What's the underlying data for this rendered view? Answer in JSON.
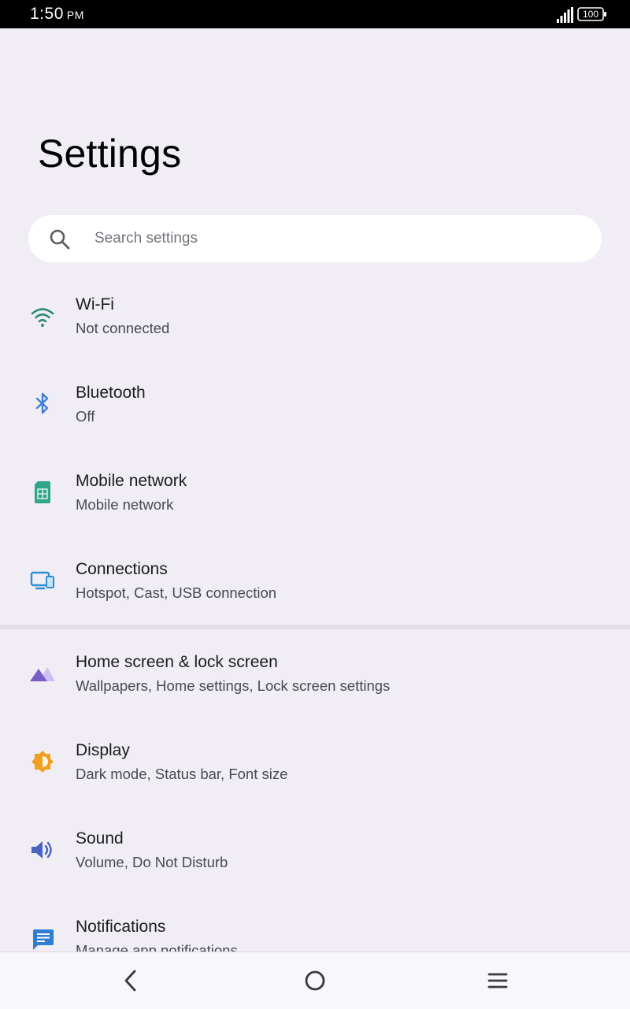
{
  "status_bar": {
    "time": "1:50",
    "ampm": "PM",
    "battery": "100"
  },
  "page": {
    "title": "Settings"
  },
  "search": {
    "placeholder": "Search settings"
  },
  "items": [
    {
      "title": "Wi-Fi",
      "subtitle": "Not connected",
      "icon": "wifi-icon",
      "color": "#2e8b7a"
    },
    {
      "title": "Bluetooth",
      "subtitle": "Off",
      "icon": "bluetooth-icon",
      "color": "#3d7fd6"
    },
    {
      "title": "Mobile network",
      "subtitle": "Mobile network",
      "icon": "sim-card-icon",
      "color": "#2fa58a"
    },
    {
      "title": "Connections",
      "subtitle": "Hotspot, Cast, USB connection",
      "icon": "devices-icon",
      "color": "#2f8fd1"
    },
    {
      "title": "Home screen & lock screen",
      "subtitle": "Wallpapers, Home settings, Lock screen settings",
      "icon": "wallpaper-icon",
      "color": "#7a5cc9"
    },
    {
      "title": "Display",
      "subtitle": "Dark mode, Status bar, Font size",
      "icon": "brightness-icon",
      "color": "#f0a020"
    },
    {
      "title": "Sound",
      "subtitle": "Volume, Do Not Disturb",
      "icon": "volume-icon",
      "color": "#4a63c4"
    },
    {
      "title": "Notifications",
      "subtitle": "Manage app notifications",
      "icon": "notification-icon",
      "color": "#2f7ed1"
    }
  ],
  "nav": {
    "back": "back-icon",
    "home": "home-icon",
    "menu": "menu-icon"
  }
}
